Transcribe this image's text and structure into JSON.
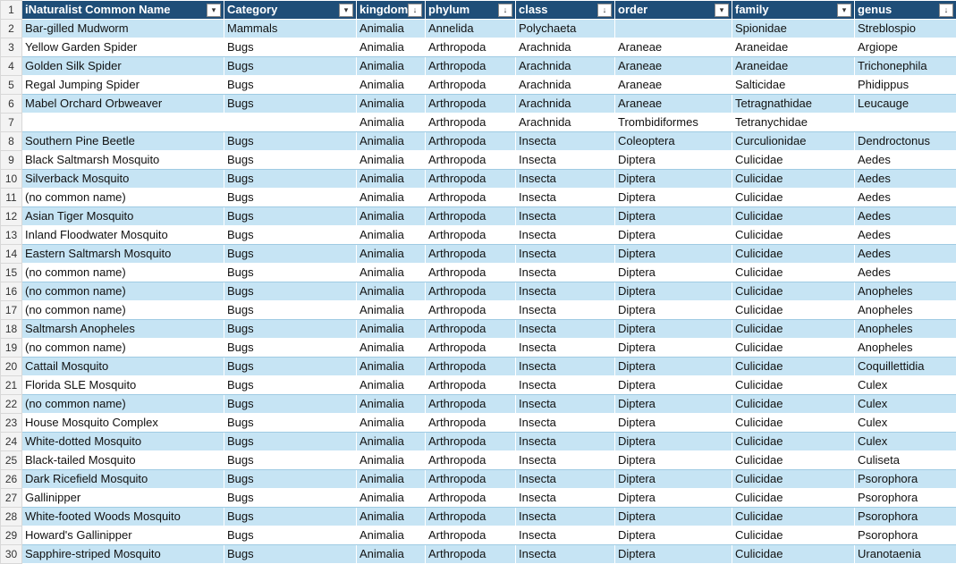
{
  "headers": [
    {
      "label": "iNaturalist Common Name",
      "filter": "▾"
    },
    {
      "label": "Category",
      "filter": "▾"
    },
    {
      "label": "kingdom",
      "filter": "↓"
    },
    {
      "label": "phylum",
      "filter": "↓"
    },
    {
      "label": "class",
      "filter": "↓"
    },
    {
      "label": "order",
      "filter": "▾"
    },
    {
      "label": "family",
      "filter": "▾"
    },
    {
      "label": "genus",
      "filter": "↓"
    }
  ],
  "row_numbers": [
    "1",
    "2",
    "3",
    "4",
    "5",
    "6",
    "7",
    "8",
    "9",
    "10",
    "11",
    "12",
    "13",
    "14",
    "15",
    "16",
    "17",
    "18",
    "19",
    "20",
    "21",
    "22",
    "23",
    "24",
    "25",
    "26",
    "27",
    "28",
    "29",
    "30"
  ],
  "rows": [
    [
      "Bar-gilled Mudworm",
      "Mammals",
      "Animalia",
      "Annelida",
      "Polychaeta",
      "",
      "Spionidae",
      "Streblospio"
    ],
    [
      "Yellow Garden Spider",
      "Bugs",
      "Animalia",
      "Arthropoda",
      "Arachnida",
      "Araneae",
      "Araneidae",
      "Argiope"
    ],
    [
      "Golden Silk Spider",
      "Bugs",
      "Animalia",
      "Arthropoda",
      "Arachnida",
      "Araneae",
      "Araneidae",
      "Trichonephila"
    ],
    [
      "Regal Jumping Spider",
      "Bugs",
      "Animalia",
      "Arthropoda",
      "Arachnida",
      "Araneae",
      "Salticidae",
      "Phidippus"
    ],
    [
      "Mabel Orchard Orbweaver",
      "Bugs",
      "Animalia",
      "Arthropoda",
      "Arachnida",
      "Araneae",
      "Tetragnathidae",
      "Leucauge"
    ],
    [
      "",
      "",
      "Animalia",
      "Arthropoda",
      "Arachnida",
      "Trombidiformes",
      "Tetranychidae",
      ""
    ],
    [
      "Southern Pine Beetle",
      "Bugs",
      "Animalia",
      "Arthropoda",
      "Insecta",
      "Coleoptera",
      "Curculionidae",
      "Dendroctonus"
    ],
    [
      "Black Saltmarsh Mosquito",
      "Bugs",
      "Animalia",
      "Arthropoda",
      "Insecta",
      "Diptera",
      "Culicidae",
      "Aedes"
    ],
    [
      "Silverback Mosquito",
      "Bugs",
      "Animalia",
      "Arthropoda",
      "Insecta",
      "Diptera",
      "Culicidae",
      "Aedes"
    ],
    [
      "(no common name)",
      "Bugs",
      "Animalia",
      "Arthropoda",
      "Insecta",
      "Diptera",
      "Culicidae",
      "Aedes"
    ],
    [
      "Asian Tiger Mosquito",
      "Bugs",
      "Animalia",
      "Arthropoda",
      "Insecta",
      "Diptera",
      "Culicidae",
      "Aedes"
    ],
    [
      "Inland Floodwater Mosquito",
      "Bugs",
      "Animalia",
      "Arthropoda",
      "Insecta",
      "Diptera",
      "Culicidae",
      "Aedes"
    ],
    [
      "Eastern Saltmarsh Mosquito",
      "Bugs",
      "Animalia",
      "Arthropoda",
      "Insecta",
      "Diptera",
      "Culicidae",
      "Aedes"
    ],
    [
      "(no common name)",
      "Bugs",
      "Animalia",
      "Arthropoda",
      "Insecta",
      "Diptera",
      "Culicidae",
      "Aedes"
    ],
    [
      "(no common name)",
      "Bugs",
      "Animalia",
      "Arthropoda",
      "Insecta",
      "Diptera",
      "Culicidae",
      "Anopheles"
    ],
    [
      "(no common name)",
      "Bugs",
      "Animalia",
      "Arthropoda",
      "Insecta",
      "Diptera",
      "Culicidae",
      "Anopheles"
    ],
    [
      "Saltmarsh Anopheles",
      "Bugs",
      "Animalia",
      "Arthropoda",
      "Insecta",
      "Diptera",
      "Culicidae",
      "Anopheles"
    ],
    [
      "(no common name)",
      "Bugs",
      "Animalia",
      "Arthropoda",
      "Insecta",
      "Diptera",
      "Culicidae",
      "Anopheles"
    ],
    [
      "Cattail Mosquito",
      "Bugs",
      "Animalia",
      "Arthropoda",
      "Insecta",
      "Diptera",
      "Culicidae",
      "Coquillettidia"
    ],
    [
      "Florida SLE Mosquito",
      "Bugs",
      "Animalia",
      "Arthropoda",
      "Insecta",
      "Diptera",
      "Culicidae",
      "Culex"
    ],
    [
      "(no common name)",
      "Bugs",
      "Animalia",
      "Arthropoda",
      "Insecta",
      "Diptera",
      "Culicidae",
      "Culex"
    ],
    [
      "House Mosquito Complex",
      "Bugs",
      "Animalia",
      "Arthropoda",
      "Insecta",
      "Diptera",
      "Culicidae",
      "Culex"
    ],
    [
      "White-dotted Mosquito",
      "Bugs",
      "Animalia",
      "Arthropoda",
      "Insecta",
      "Diptera",
      "Culicidae",
      "Culex"
    ],
    [
      "Black-tailed Mosquito",
      "Bugs",
      "Animalia",
      "Arthropoda",
      "Insecta",
      "Diptera",
      "Culicidae",
      "Culiseta"
    ],
    [
      "Dark Ricefield Mosquito",
      "Bugs",
      "Animalia",
      "Arthropoda",
      "Insecta",
      "Diptera",
      "Culicidae",
      "Psorophora"
    ],
    [
      "Gallinipper",
      "Bugs",
      "Animalia",
      "Arthropoda",
      "Insecta",
      "Diptera",
      "Culicidae",
      "Psorophora"
    ],
    [
      "White-footed Woods Mosquito",
      "Bugs",
      "Animalia",
      "Arthropoda",
      "Insecta",
      "Diptera",
      "Culicidae",
      "Psorophora"
    ],
    [
      "Howard's Gallinipper",
      "Bugs",
      "Animalia",
      "Arthropoda",
      "Insecta",
      "Diptera",
      "Culicidae",
      "Psorophora"
    ],
    [
      "Sapphire-striped Mosquito",
      "Bugs",
      "Animalia",
      "Arthropoda",
      "Insecta",
      "Diptera",
      "Culicidae",
      "Uranotaenia"
    ]
  ],
  "colors": {
    "header_bg": "#1f4e78",
    "band_light": "#c6e4f4",
    "band_white": "#ffffff"
  }
}
